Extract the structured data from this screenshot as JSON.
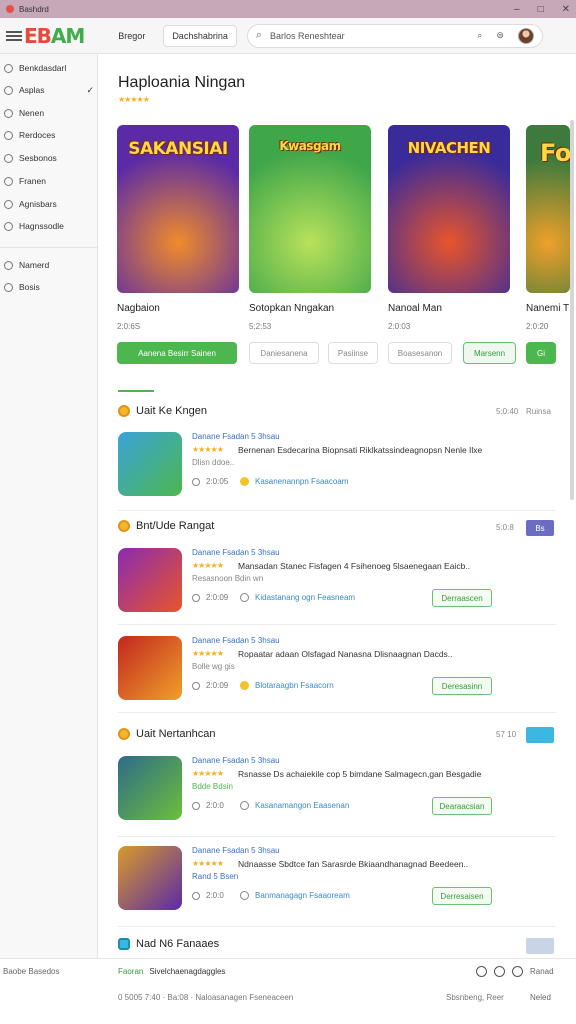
{
  "window": {
    "title": "Bashdrd",
    "controls": [
      "–",
      "□",
      "✕"
    ]
  },
  "toolbar": {
    "logo_part1": "EB",
    "logo_part2": "AM",
    "tab1": "Bregor",
    "tab2": "Dachshabrina",
    "search_value": "Barlos Reneshtear"
  },
  "sidebar": {
    "items": [
      {
        "label": "Benkdasdarl",
        "checked": false
      },
      {
        "label": "Asplas",
        "checked": true
      },
      {
        "label": "Nenen",
        "checked": false
      },
      {
        "label": "Rerdoces",
        "checked": false
      },
      {
        "label": "Sesbonos",
        "checked": false
      },
      {
        "label": "Franen",
        "checked": false
      },
      {
        "label": "Agnisbars",
        "checked": false
      },
      {
        "label": "Hagnssodle",
        "checked": false
      }
    ],
    "items2": [
      {
        "label": "Namerd"
      },
      {
        "label": "Bosis"
      }
    ]
  },
  "page": {
    "title": "Haploania Ningan",
    "rating": "★★★★★"
  },
  "featured": [
    {
      "art_text": "SAKANSIAI",
      "name": "Nagbaion",
      "meta": "2:0:6S",
      "bg": "#5b2aa6",
      "accent": "#f08c2a"
    },
    {
      "art_text": "Kwasgam",
      "name": "Sotopkan Nngakan",
      "meta": "5:2:53",
      "bg": "#3fa64a",
      "accent": "#b9e25b"
    },
    {
      "art_text": "NIVACHEN",
      "name": "Nanoal Man",
      "meta": "2:0:03",
      "bg": "#3a2b9a",
      "accent": "#e8552a"
    },
    {
      "art_text": "Fo",
      "name": "Nanemi T",
      "meta": "2:0:20",
      "bg": "#3e7a3d",
      "accent": "#f0a02a"
    }
  ],
  "pills": [
    {
      "label": "Aanena Besirr Sainen",
      "kind": "green"
    },
    {
      "label": "Daniesanena",
      "kind": "ghost"
    },
    {
      "label": "Pasiinse",
      "kind": "ghost"
    },
    {
      "label": "Boasesanon",
      "kind": "ghost"
    },
    {
      "label": "Marsenn",
      "kind": "outline"
    },
    {
      "label": "Gi",
      "kind": "green"
    }
  ],
  "sections": [
    {
      "title": "Uait Ke Kngen",
      "meta": "5:0:40",
      "tag": "Ruinsa",
      "rows": [
        {
          "title": "Danane Fsadan 5 3hsau",
          "stars": "★★★★★",
          "desc": "Bernenan Esdecarina Biopnsati Riklkatssindeagnopsn Nenle Ilxe",
          "sub": "Dlisn ddoe..",
          "size": "2:0:05",
          "link": "Kasanenannpn Fsaacoam",
          "btn": ""
        }
      ]
    },
    {
      "title": "Bnt/Ude Rangat",
      "meta": "5:0:8",
      "tag": "Bs",
      "rows": [
        {
          "title": "Danane Fsadan 5 3hsau",
          "stars": "★★★★★",
          "desc": "Mansadan Stanec Fisfagen 4 Fsihenoeg 5lsaenegaan Eaicb..",
          "sub": "Resasnoon Bdin wn",
          "size": "2:0:09",
          "link": "Kidastanang ogn Feasneam",
          "btn": "Derraascen"
        },
        {
          "title": "Danane Fsadan 5 3hsau",
          "stars": "★★★★★",
          "desc": "Ropaatar adaan Olsfagad Nanasna Dlisnaagnan Dacds..",
          "sub": "Bolle wg gis",
          "size": "2:0:09",
          "link": "Blotaraagbn Fsaacorn",
          "btn": "Deresasinn"
        }
      ]
    },
    {
      "title": "Uait Nertanhcan",
      "meta": "57 10",
      "tag": "",
      "rows": [
        {
          "title": "Danane Fsadan 5 3hsau",
          "stars": "★★★★★",
          "desc": "Rsnasse Ds achaiekile cop 5 bimdane Salmagecn,gan Besgadie",
          "sub": "Bdde Bdsin",
          "size": "2:0:0",
          "link": "Kasanamangon Eaasenan",
          "btn": "Dearaacsian"
        },
        {
          "title": "Danane Fsadan 5 3hsau",
          "stars": "★★★★★",
          "desc": "Ndnaasse Sbdtce fan Sarasrde Bkiaandhanagnad Beedeen..",
          "sub": "Rand 5 Bsen",
          "size": "2:0:0",
          "link": "Banmanagagn Fsaaoream",
          "btn": "Derresaisen"
        }
      ]
    }
  ],
  "bottom_section": {
    "title": "Nad N6 Fanaaes"
  },
  "footer": {
    "left_label": "Baobe Basedos",
    "title_green": "Faoran",
    "title_rest": "Sivelchaenagdaggles",
    "right_label": "Ranad",
    "row2": "0  5005 7:40  ·  Ba:08  ·  Naloasanagen Fseneaceen",
    "row2_right": "Sbsnbeng, Reer",
    "row2_right2": "Neled"
  },
  "colors": {
    "accent_green": "#4cb74f",
    "link_blue": "#3a6fc4",
    "badge_purple": "#6c6cc4",
    "badge_cyan": "#3ab8e0"
  }
}
